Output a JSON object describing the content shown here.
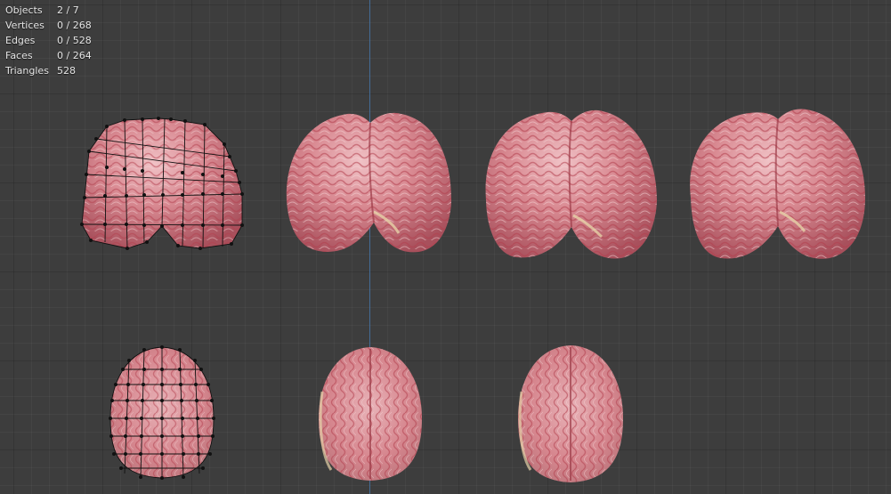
{
  "stats": [
    {
      "label": "Objects",
      "value": "2 / 7"
    },
    {
      "label": "Vertices",
      "value": "0 / 268"
    },
    {
      "label": "Edges",
      "value": "0 / 528"
    },
    {
      "label": "Faces",
      "value": "0 / 264"
    },
    {
      "label": "Triangles",
      "value": "528"
    }
  ],
  "colors": {
    "background": "#3d3d3d",
    "axis": "#4a7fb8",
    "brain_base": "#d98a92",
    "brain_dark": "#b04a58",
    "wire": "#111111"
  }
}
